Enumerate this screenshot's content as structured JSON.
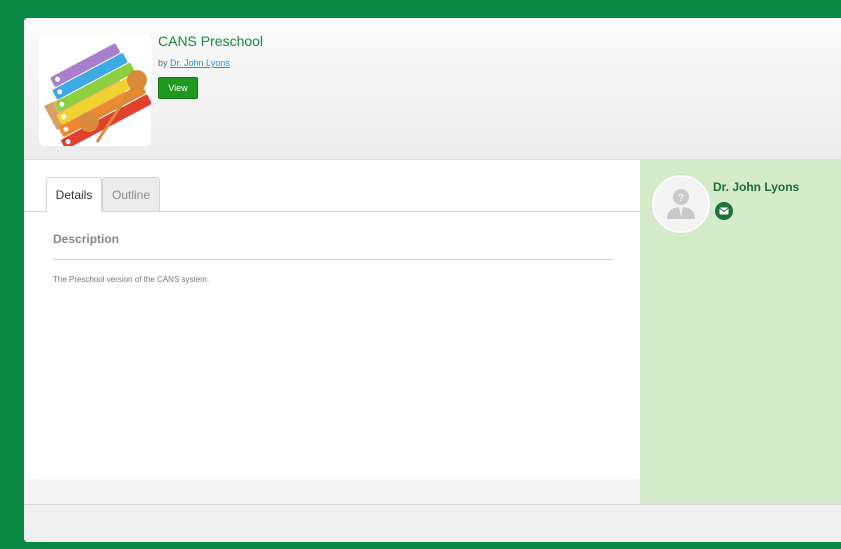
{
  "course": {
    "title": "CANS Preschool",
    "by_prefix": "by",
    "author_link": "Dr. John Lyons",
    "view_label": "View",
    "thumbnail_icon": "xylophone-icon"
  },
  "tabs": [
    {
      "label": "Details",
      "active": true
    },
    {
      "label": "Outline",
      "active": false
    }
  ],
  "details": {
    "heading": "Description",
    "text": "The Preschool version of the CANS system."
  },
  "sidebar": {
    "author_name": "Dr. John Lyons",
    "avatar_icon": "avatar-placeholder-icon",
    "mail_icon": "mail-icon"
  },
  "colors": {
    "frame_green": "#0b8a43",
    "title_green": "#138a3e",
    "button_green": "#1d9a1d",
    "sidebar_bg": "#d4ebc9",
    "author_green": "#1c6b39"
  }
}
